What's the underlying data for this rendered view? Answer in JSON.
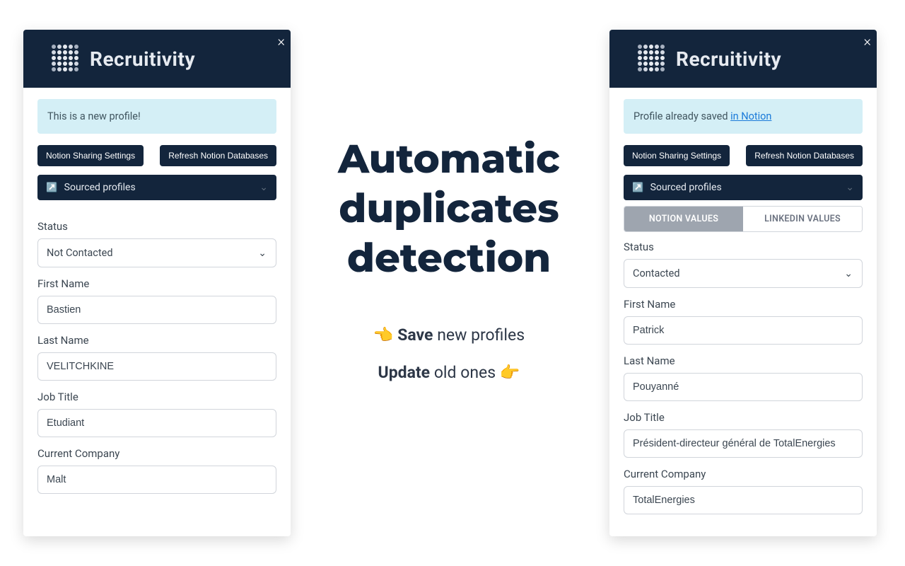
{
  "brand": "Recruitivity",
  "center": {
    "headline_l1": "Automatic",
    "headline_l2": "duplicates",
    "headline_l3": "detection",
    "line1_emoji": "👈",
    "line1_strong": "Save",
    "line1_rest": " new profiles",
    "line2_strong": "Update",
    "line2_rest": " old ones ",
    "line2_emoji": "👉"
  },
  "left": {
    "banner": "This is a new profile!",
    "btn_sharing": "Notion Sharing Settings",
    "btn_refresh": "Refresh Notion Databases",
    "db_emoji": "↗️",
    "db_name": "Sourced profiles",
    "fields": {
      "status_label": "Status",
      "status_value": "Not Contacted",
      "first_name_label": "First Name",
      "first_name_value": "Bastien",
      "last_name_label": "Last Name",
      "last_name_value": "VELITCHKINE",
      "job_title_label": "Job Title",
      "job_title_value": "Etudiant",
      "company_label": "Current Company",
      "company_value": "Malt"
    }
  },
  "right": {
    "banner_prefix": "Profile already saved ",
    "banner_link": "in Notion",
    "btn_sharing": "Notion Sharing Settings",
    "btn_refresh": "Refresh Notion Databases",
    "db_emoji": "↗️",
    "db_name": "Sourced profiles",
    "tabs": {
      "notion": "NOTION VALUES",
      "linkedin": "LINKEDIN VALUES"
    },
    "fields": {
      "status_label": "Status",
      "status_value": "Contacted",
      "first_name_label": "First Name",
      "first_name_value": "Patrick",
      "last_name_label": "Last Name",
      "last_name_value": "Pouyanné",
      "job_title_label": "Job Title",
      "job_title_value": "Président-directeur général de TotalEnergies",
      "company_label": "Current Company",
      "company_value": "TotalEnergies"
    }
  }
}
